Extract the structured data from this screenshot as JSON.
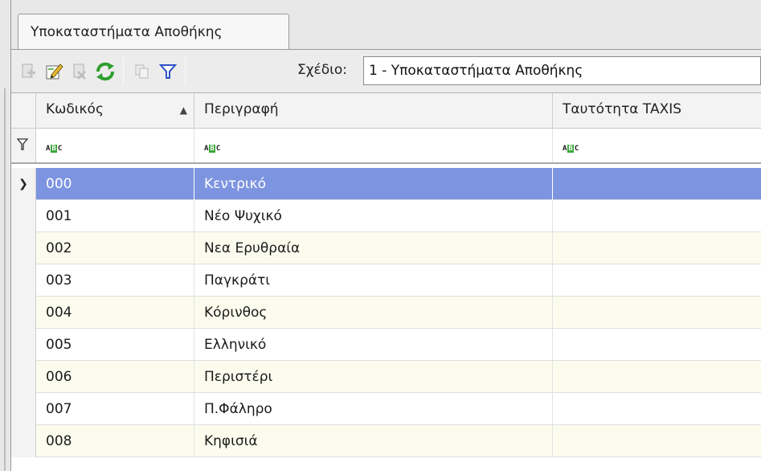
{
  "tab": {
    "label": "Υποκαταστήματα Αποθήκης"
  },
  "toolbar": {
    "plan_label": "Σχέδιο:",
    "plan_value": "1 - Υποκαταστήματα Αποθήκης",
    "icons": [
      "add-icon",
      "edit-icon",
      "delete-icon",
      "refresh-icon",
      "copy-icon",
      "filter-icon"
    ]
  },
  "grid": {
    "columns": [
      "Κωδικός",
      "Περιγραφή",
      "Ταυτότητα TAXIS"
    ],
    "sort_column": "Κωδικός",
    "sort_direction": "ascending",
    "filter_placeholder": "ABC",
    "rows": [
      {
        "code": "000",
        "description": "Κεντρικό",
        "taxis": "",
        "selected": true
      },
      {
        "code": "001",
        "description": "Νέο Ψυχικό",
        "taxis": ""
      },
      {
        "code": "002",
        "description": "Νεα Ερυθραία",
        "taxis": ""
      },
      {
        "code": "003",
        "description": "Παγκράτι",
        "taxis": ""
      },
      {
        "code": "004",
        "description": "Κόρινθος",
        "taxis": ""
      },
      {
        "code": "005",
        "description": "Ελληνικό",
        "taxis": ""
      },
      {
        "code": "006",
        "description": "Περιστέρι",
        "taxis": ""
      },
      {
        "code": "007",
        "description": "Π.Φάληρο",
        "taxis": ""
      },
      {
        "code": "008",
        "description": "Κηφισιά",
        "taxis": ""
      }
    ]
  },
  "colors": {
    "selected_row": "#7d94e0",
    "alt_row": "#fcfcee",
    "refresh_green": "#2e9e2e",
    "filter_blue": "#2b52c8"
  }
}
